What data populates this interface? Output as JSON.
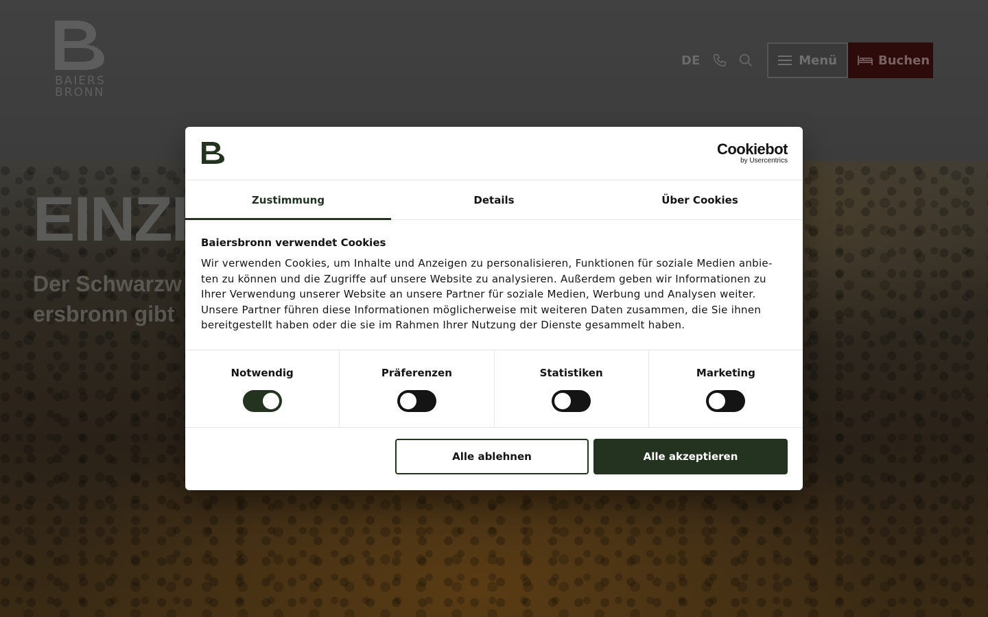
{
  "site": {
    "logo_text_line1": "BAIERS",
    "logo_text_line2": "BRONN",
    "language": "DE",
    "menu_label": "Menü",
    "book_label": "Buchen",
    "hero_headline": "EINZIG",
    "hero_sub_line1": "Der Schwarzw",
    "hero_sub_line2": "ersbronn gibt"
  },
  "consent": {
    "provider_name": "Cookiebot",
    "provider_sub": "by Usercentrics",
    "tabs": [
      "Zustimmung",
      "Details",
      "Über Cookies"
    ],
    "active_tab": "Zustimmung",
    "title": "Baiersbronn verwendet Cookies",
    "body": "Wir verwenden Cookies, um Inhalte und Anzeigen zu personalisieren, Funktionen für soziale Medien anbie-ten zu können und die Zugriffe auf unsere Website zu analysieren. Außerdem geben wir Informationen zu Ihrer Verwendung unserer Website an unsere Partner für soziale Medien, Werbung und Analysen weiter. Unsere Partner führen diese Informationen möglicherweise mit weiteren Daten zusammen, die Sie ihnen bereitgestellt haben oder die sie im Rahmen Ihrer Nutzung der Dienste gesammelt haben.",
    "categories": [
      {
        "label": "Notwendig",
        "enabled": true
      },
      {
        "label": "Präferenzen",
        "enabled": false
      },
      {
        "label": "Statistiken",
        "enabled": false
      },
      {
        "label": "Marketing",
        "enabled": false
      }
    ],
    "decline_label": "Alle ablehnen",
    "accept_label": "Alle akzeptieren"
  },
  "colors": {
    "accent_dark_green": "#24331f",
    "book_button_bg": "#2e0b0b"
  },
  "icons": [
    "phone-icon",
    "search-icon",
    "menu-icon",
    "bed-icon",
    "baiersbronn-logo-icon"
  ]
}
